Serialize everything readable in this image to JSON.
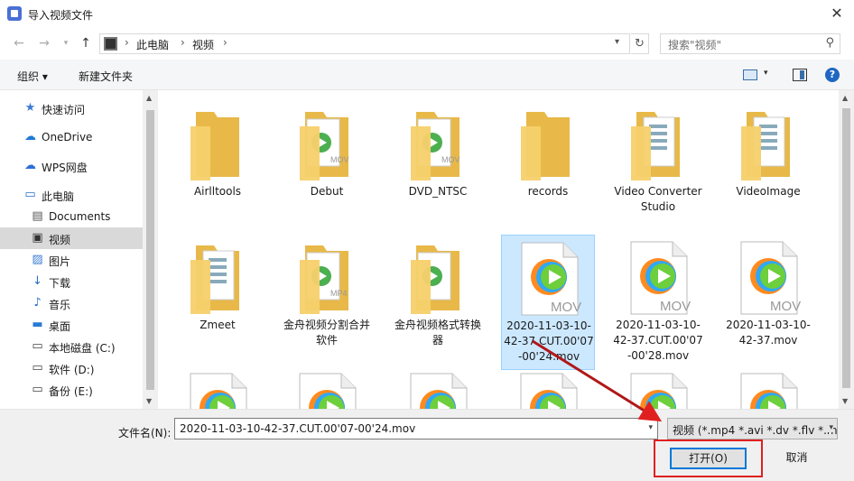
{
  "window": {
    "title": "导入视频文件"
  },
  "address": {
    "crumbs": [
      "此电脑",
      "视频"
    ]
  },
  "search": {
    "placeholder": "搜索\"视频\""
  },
  "toolbar": {
    "organize": "组织 ▾",
    "new_folder": "新建文件夹"
  },
  "sidebar": {
    "items": [
      {
        "label": "快速访问",
        "icon": "star-icon"
      },
      {
        "label": "OneDrive",
        "icon": "cloud-icon"
      },
      {
        "label": "WPS网盘",
        "icon": "wps-cloud-icon"
      },
      {
        "label": "此电脑",
        "icon": "computer-icon"
      },
      {
        "label": "Documents",
        "icon": "document-icon"
      },
      {
        "label": "视频",
        "icon": "video-folder-icon"
      },
      {
        "label": "图片",
        "icon": "picture-icon"
      },
      {
        "label": "下载",
        "icon": "download-icon"
      },
      {
        "label": "音乐",
        "icon": "music-icon"
      },
      {
        "label": "桌面",
        "icon": "desktop-icon"
      },
      {
        "label": "本地磁盘 (C:)",
        "icon": "drive-icon"
      },
      {
        "label": "软件 (D:)",
        "icon": "drive-icon"
      },
      {
        "label": "备份 (E:)",
        "icon": "drive-icon"
      }
    ]
  },
  "files": [
    {
      "label": "Airlltools",
      "kind": "folder"
    },
    {
      "label": "Debut",
      "kind": "folder-mov"
    },
    {
      "label": "DVD_NTSC",
      "kind": "folder-mov"
    },
    {
      "label": "records",
      "kind": "folder"
    },
    {
      "label": "Video Converter Studio",
      "kind": "folder-doc"
    },
    {
      "label": "VideoImage",
      "kind": "folder-doc"
    },
    {
      "label": "Zmeet",
      "kind": "folder-doc"
    },
    {
      "label": "金舟视频分割合并软件",
      "kind": "folder-mp4"
    },
    {
      "label": "金舟视频格式转换器",
      "kind": "folder-play"
    },
    {
      "label": "2020-11-03-10-42-37.CUT.00'07-00'24.mov",
      "kind": "mov"
    },
    {
      "label": "2020-11-03-10-42-37.CUT.00'07-00'28.mov",
      "kind": "mov"
    },
    {
      "label": "2020-11-03-10-42-37.mov",
      "kind": "mov"
    },
    {
      "label": "",
      "kind": "mov"
    },
    {
      "label": "",
      "kind": "mov"
    },
    {
      "label": "",
      "kind": "mov"
    },
    {
      "label": "",
      "kind": "mov"
    },
    {
      "label": "",
      "kind": "mov"
    },
    {
      "label": "",
      "kind": "mov"
    }
  ],
  "footer": {
    "filename_label": "文件名(N):",
    "filename_value": "2020-11-03-10-42-37.CUT.00'07-00'24.mov",
    "filetype": "视频 (*.mp4 *.avi *.dv *.flv *.m",
    "open_button": "打开(O)",
    "cancel_button": "取消"
  },
  "colors": {
    "accent": "#0078d7",
    "selected": "#cce8ff",
    "annotation": "#e02020"
  }
}
